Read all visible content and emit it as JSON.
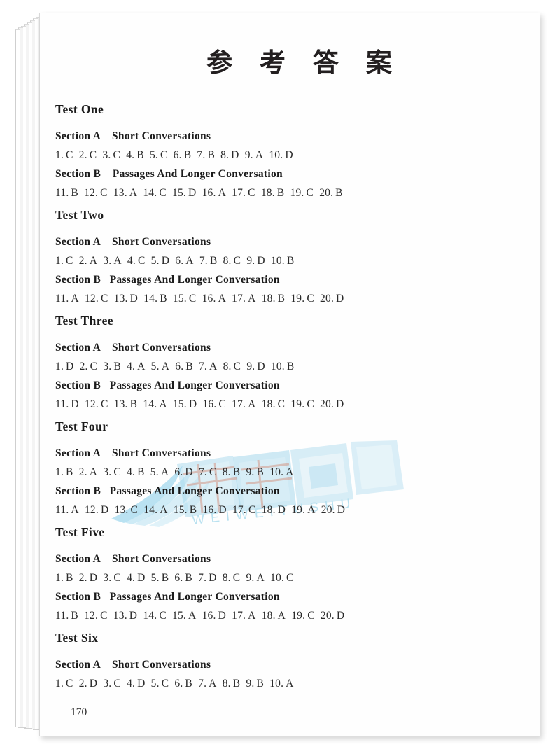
{
  "document": {
    "title": "参 考 答 案",
    "page_number": "170"
  },
  "watermark": {
    "chinese": "蔚蔚图书",
    "pinyin": "WEIWEITUSHU",
    "color": "#7ecbe8"
  },
  "labels": {
    "section_a": "Section A    Short Conversations",
    "section_b": "Section B    Passages And Longer Conversation"
  },
  "tests": [
    {
      "title": "Test One",
      "section_a_label": "Section A    Short Conversations",
      "section_a_answers": [
        {
          "num": "1.",
          "letter": "C"
        },
        {
          "num": "2.",
          "letter": "C"
        },
        {
          "num": "3.",
          "letter": "C"
        },
        {
          "num": "4.",
          "letter": "B"
        },
        {
          "num": "5.",
          "letter": "C"
        },
        {
          "num": "6.",
          "letter": "B"
        },
        {
          "num": "7.",
          "letter": "B"
        },
        {
          "num": "8.",
          "letter": "D"
        },
        {
          "num": "9.",
          "letter": "A"
        },
        {
          "num": "10.",
          "letter": "D"
        }
      ],
      "section_b_label": "Section B    Passages And Longer Conversation",
      "section_b_answers": [
        {
          "num": "11.",
          "letter": "B"
        },
        {
          "num": "12.",
          "letter": "C"
        },
        {
          "num": "13.",
          "letter": "A"
        },
        {
          "num": "14.",
          "letter": "C"
        },
        {
          "num": "15.",
          "letter": "D"
        },
        {
          "num": "16.",
          "letter": "A"
        },
        {
          "num": "17.",
          "letter": "C"
        },
        {
          "num": "18.",
          "letter": "B"
        },
        {
          "num": "19.",
          "letter": "C"
        },
        {
          "num": "20.",
          "letter": "B"
        }
      ]
    },
    {
      "title": "Test Two",
      "section_a_label": "Section A    Short Conversations",
      "section_a_answers": [
        {
          "num": "1.",
          "letter": "C"
        },
        {
          "num": "2.",
          "letter": "A"
        },
        {
          "num": "3.",
          "letter": "A"
        },
        {
          "num": "4.",
          "letter": "C"
        },
        {
          "num": "5.",
          "letter": "D"
        },
        {
          "num": "6.",
          "letter": "A"
        },
        {
          "num": "7.",
          "letter": "B"
        },
        {
          "num": "8.",
          "letter": "C"
        },
        {
          "num": "9.",
          "letter": "D"
        },
        {
          "num": "10.",
          "letter": "B"
        }
      ],
      "section_b_label": "Section B   Passages And Longer Conversation",
      "section_b_answers": [
        {
          "num": "11.",
          "letter": "A"
        },
        {
          "num": "12.",
          "letter": "C"
        },
        {
          "num": "13.",
          "letter": "D"
        },
        {
          "num": "14.",
          "letter": "B"
        },
        {
          "num": "15.",
          "letter": "C"
        },
        {
          "num": "16.",
          "letter": "A"
        },
        {
          "num": "17.",
          "letter": "A"
        },
        {
          "num": "18.",
          "letter": "B"
        },
        {
          "num": "19.",
          "letter": "C"
        },
        {
          "num": "20.",
          "letter": "D"
        }
      ]
    },
    {
      "title": "Test Three",
      "section_a_label": "Section A    Short Conversations",
      "section_a_answers": [
        {
          "num": "1.",
          "letter": "D"
        },
        {
          "num": "2.",
          "letter": "C"
        },
        {
          "num": "3.",
          "letter": "B"
        },
        {
          "num": "4.",
          "letter": "A"
        },
        {
          "num": "5.",
          "letter": "A"
        },
        {
          "num": "6.",
          "letter": "B"
        },
        {
          "num": "7.",
          "letter": "A"
        },
        {
          "num": "8.",
          "letter": "C"
        },
        {
          "num": "9.",
          "letter": "D"
        },
        {
          "num": "10.",
          "letter": "B"
        }
      ],
      "section_b_label": "Section B   Passages And Longer Conversation",
      "section_b_answers": [
        {
          "num": "11.",
          "letter": "D"
        },
        {
          "num": "12.",
          "letter": "C"
        },
        {
          "num": "13.",
          "letter": "B"
        },
        {
          "num": "14.",
          "letter": "A"
        },
        {
          "num": "15.",
          "letter": "D"
        },
        {
          "num": "16.",
          "letter": "C"
        },
        {
          "num": "17.",
          "letter": "A"
        },
        {
          "num": "18.",
          "letter": "C"
        },
        {
          "num": "19.",
          "letter": "C"
        },
        {
          "num": "20.",
          "letter": "D"
        }
      ]
    },
    {
      "title": "Test Four",
      "section_a_label": "Section A    Short Conversations",
      "section_a_answers": [
        {
          "num": "1.",
          "letter": "B"
        },
        {
          "num": "2.",
          "letter": "A"
        },
        {
          "num": "3.",
          "letter": "C"
        },
        {
          "num": "4.",
          "letter": "B"
        },
        {
          "num": "5.",
          "letter": "A"
        },
        {
          "num": "6.",
          "letter": "D"
        },
        {
          "num": "7.",
          "letter": "C"
        },
        {
          "num": "8.",
          "letter": "B"
        },
        {
          "num": "9.",
          "letter": "B"
        },
        {
          "num": "10.",
          "letter": "A"
        }
      ],
      "section_b_label": "Section B   Passages And Longer Conversation",
      "section_b_answers": [
        {
          "num": "11.",
          "letter": "A"
        },
        {
          "num": "12.",
          "letter": "D"
        },
        {
          "num": "13.",
          "letter": "C"
        },
        {
          "num": "14.",
          "letter": "A"
        },
        {
          "num": "15.",
          "letter": "B"
        },
        {
          "num": "16.",
          "letter": "D"
        },
        {
          "num": "17.",
          "letter": "C"
        },
        {
          "num": "18.",
          "letter": "D"
        },
        {
          "num": "19.",
          "letter": "A"
        },
        {
          "num": "20.",
          "letter": "D"
        }
      ]
    },
    {
      "title": "Test Five",
      "section_a_label": "Section A    Short Conversations",
      "section_a_answers": [
        {
          "num": "1.",
          "letter": "B"
        },
        {
          "num": "2.",
          "letter": "D"
        },
        {
          "num": "3.",
          "letter": "C"
        },
        {
          "num": "4.",
          "letter": "D"
        },
        {
          "num": "5.",
          "letter": "B"
        },
        {
          "num": "6.",
          "letter": "B"
        },
        {
          "num": "7.",
          "letter": "D"
        },
        {
          "num": "8.",
          "letter": "C"
        },
        {
          "num": "9.",
          "letter": "A"
        },
        {
          "num": "10.",
          "letter": "C"
        }
      ],
      "section_b_label": "Section B   Passages And Longer Conversation",
      "section_b_answers": [
        {
          "num": "11.",
          "letter": "B"
        },
        {
          "num": "12.",
          "letter": "C"
        },
        {
          "num": "13.",
          "letter": "D"
        },
        {
          "num": "14.",
          "letter": "C"
        },
        {
          "num": "15.",
          "letter": "A"
        },
        {
          "num": "16.",
          "letter": "D"
        },
        {
          "num": "17.",
          "letter": "A"
        },
        {
          "num": "18.",
          "letter": "A"
        },
        {
          "num": "19.",
          "letter": "C"
        },
        {
          "num": "20.",
          "letter": "D"
        }
      ]
    },
    {
      "title": "Test Six",
      "section_a_label": "Section A    Short Conversations",
      "section_a_answers": [
        {
          "num": "1.",
          "letter": "C"
        },
        {
          "num": "2.",
          "letter": "D"
        },
        {
          "num": "3.",
          "letter": "C"
        },
        {
          "num": "4.",
          "letter": "D"
        },
        {
          "num": "5.",
          "letter": "C"
        },
        {
          "num": "6.",
          "letter": "B"
        },
        {
          "num": "7.",
          "letter": "A"
        },
        {
          "num": "8.",
          "letter": "B"
        },
        {
          "num": "9.",
          "letter": "B"
        },
        {
          "num": "10.",
          "letter": "A"
        }
      ],
      "section_b_label": null,
      "section_b_answers": []
    }
  ]
}
